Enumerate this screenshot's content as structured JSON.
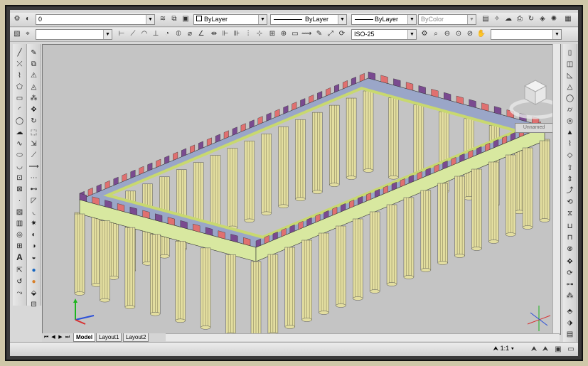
{
  "toolbar1": {
    "layer_value": "0",
    "color_value": "ByLayer",
    "linetype_value": "ByLayer",
    "lineweight_value": "ByLayer",
    "plotstyle_value": "ByColor"
  },
  "toolbar2": {
    "dimstyle_value": "ISO-25"
  },
  "viewcube": {
    "label": "Unnamed"
  },
  "layout_tabs": [
    "Model",
    "Layout1",
    "Layout2"
  ],
  "status": {
    "annotation_scale": "1:1"
  },
  "colors": {
    "viewport_bg": "#c4c4c4",
    "column_fill": "#e3dea0",
    "entablature": "#d8e8a0",
    "metope_red": "#e07070",
    "triglyph_purple": "#7a4a90",
    "cornice": "#9aa6c8"
  }
}
